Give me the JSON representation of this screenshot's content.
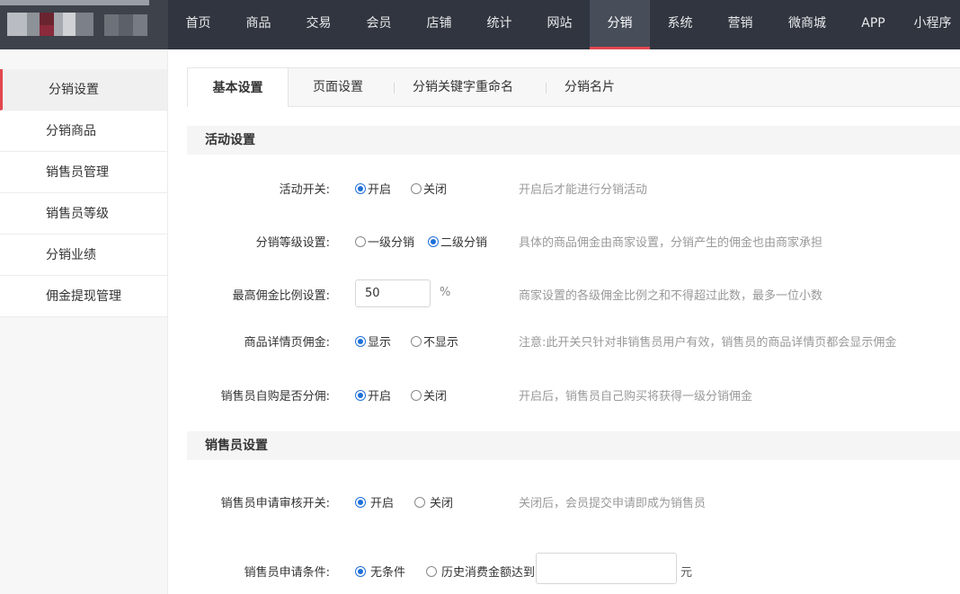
{
  "nav": {
    "items": [
      "首页",
      "商品",
      "交易",
      "会员",
      "店铺",
      "统计",
      "网站",
      "分销",
      "系统",
      "营销",
      "微商城",
      "APP",
      "小程序"
    ],
    "active_index": 7
  },
  "sidebar": {
    "items": [
      "分销设置",
      "分销商品",
      "销售员管理",
      "销售员等级",
      "分销业绩",
      "佣金提现管理"
    ],
    "active_index": 0
  },
  "tabs": {
    "items": [
      "基本设置",
      "页面设置",
      "分销关键字重命名",
      "分销名片"
    ],
    "active_index": 0
  },
  "activity": {
    "title": "活动设置",
    "switch": {
      "label": "活动开关:",
      "options": [
        "开启",
        "关闭"
      ],
      "selected": 0,
      "hint": "开启后才能进行分销活动"
    },
    "level": {
      "label": "分销等级设置:",
      "options": [
        "一级分销",
        "二级分销"
      ],
      "selected": 1,
      "hint": "具体的商品佣金由商家设置，分销产生的佣金也由商家承担"
    },
    "max_ratio": {
      "label": "最高佣金比例设置:",
      "value": "50",
      "unit": "%",
      "hint": "商家设置的各级佣金比例之和不得超过此数，最多一位小数"
    },
    "detail_commission": {
      "label": "商品详情页佣金:",
      "options": [
        "显示",
        "不显示"
      ],
      "selected": 0,
      "hint": "注意:此开关只针对非销售员用户有效，销售员的商品详情页都会显示佣金"
    },
    "self_purchase": {
      "label": "销售员自购是否分佣:",
      "options": [
        "开启",
        "关闭"
      ],
      "selected": 0,
      "hint": "开启后，销售员自己购买将获得一级分销佣金"
    }
  },
  "seller": {
    "title": "销售员设置",
    "audit": {
      "label": "销售员申请审核开关:",
      "options": [
        "开启",
        "关闭"
      ],
      "selected": 0,
      "hint": "关闭后，会员提交申请即成为销售员"
    },
    "condition": {
      "label": "销售员申请条件:",
      "options": [
        "无条件",
        "历史消费金额达到"
      ],
      "selected": 0,
      "value": "",
      "unit": "元"
    }
  },
  "colors": {
    "accent": "#e2474f",
    "radio": "#1e6fd9",
    "topbar": "#30353f"
  }
}
